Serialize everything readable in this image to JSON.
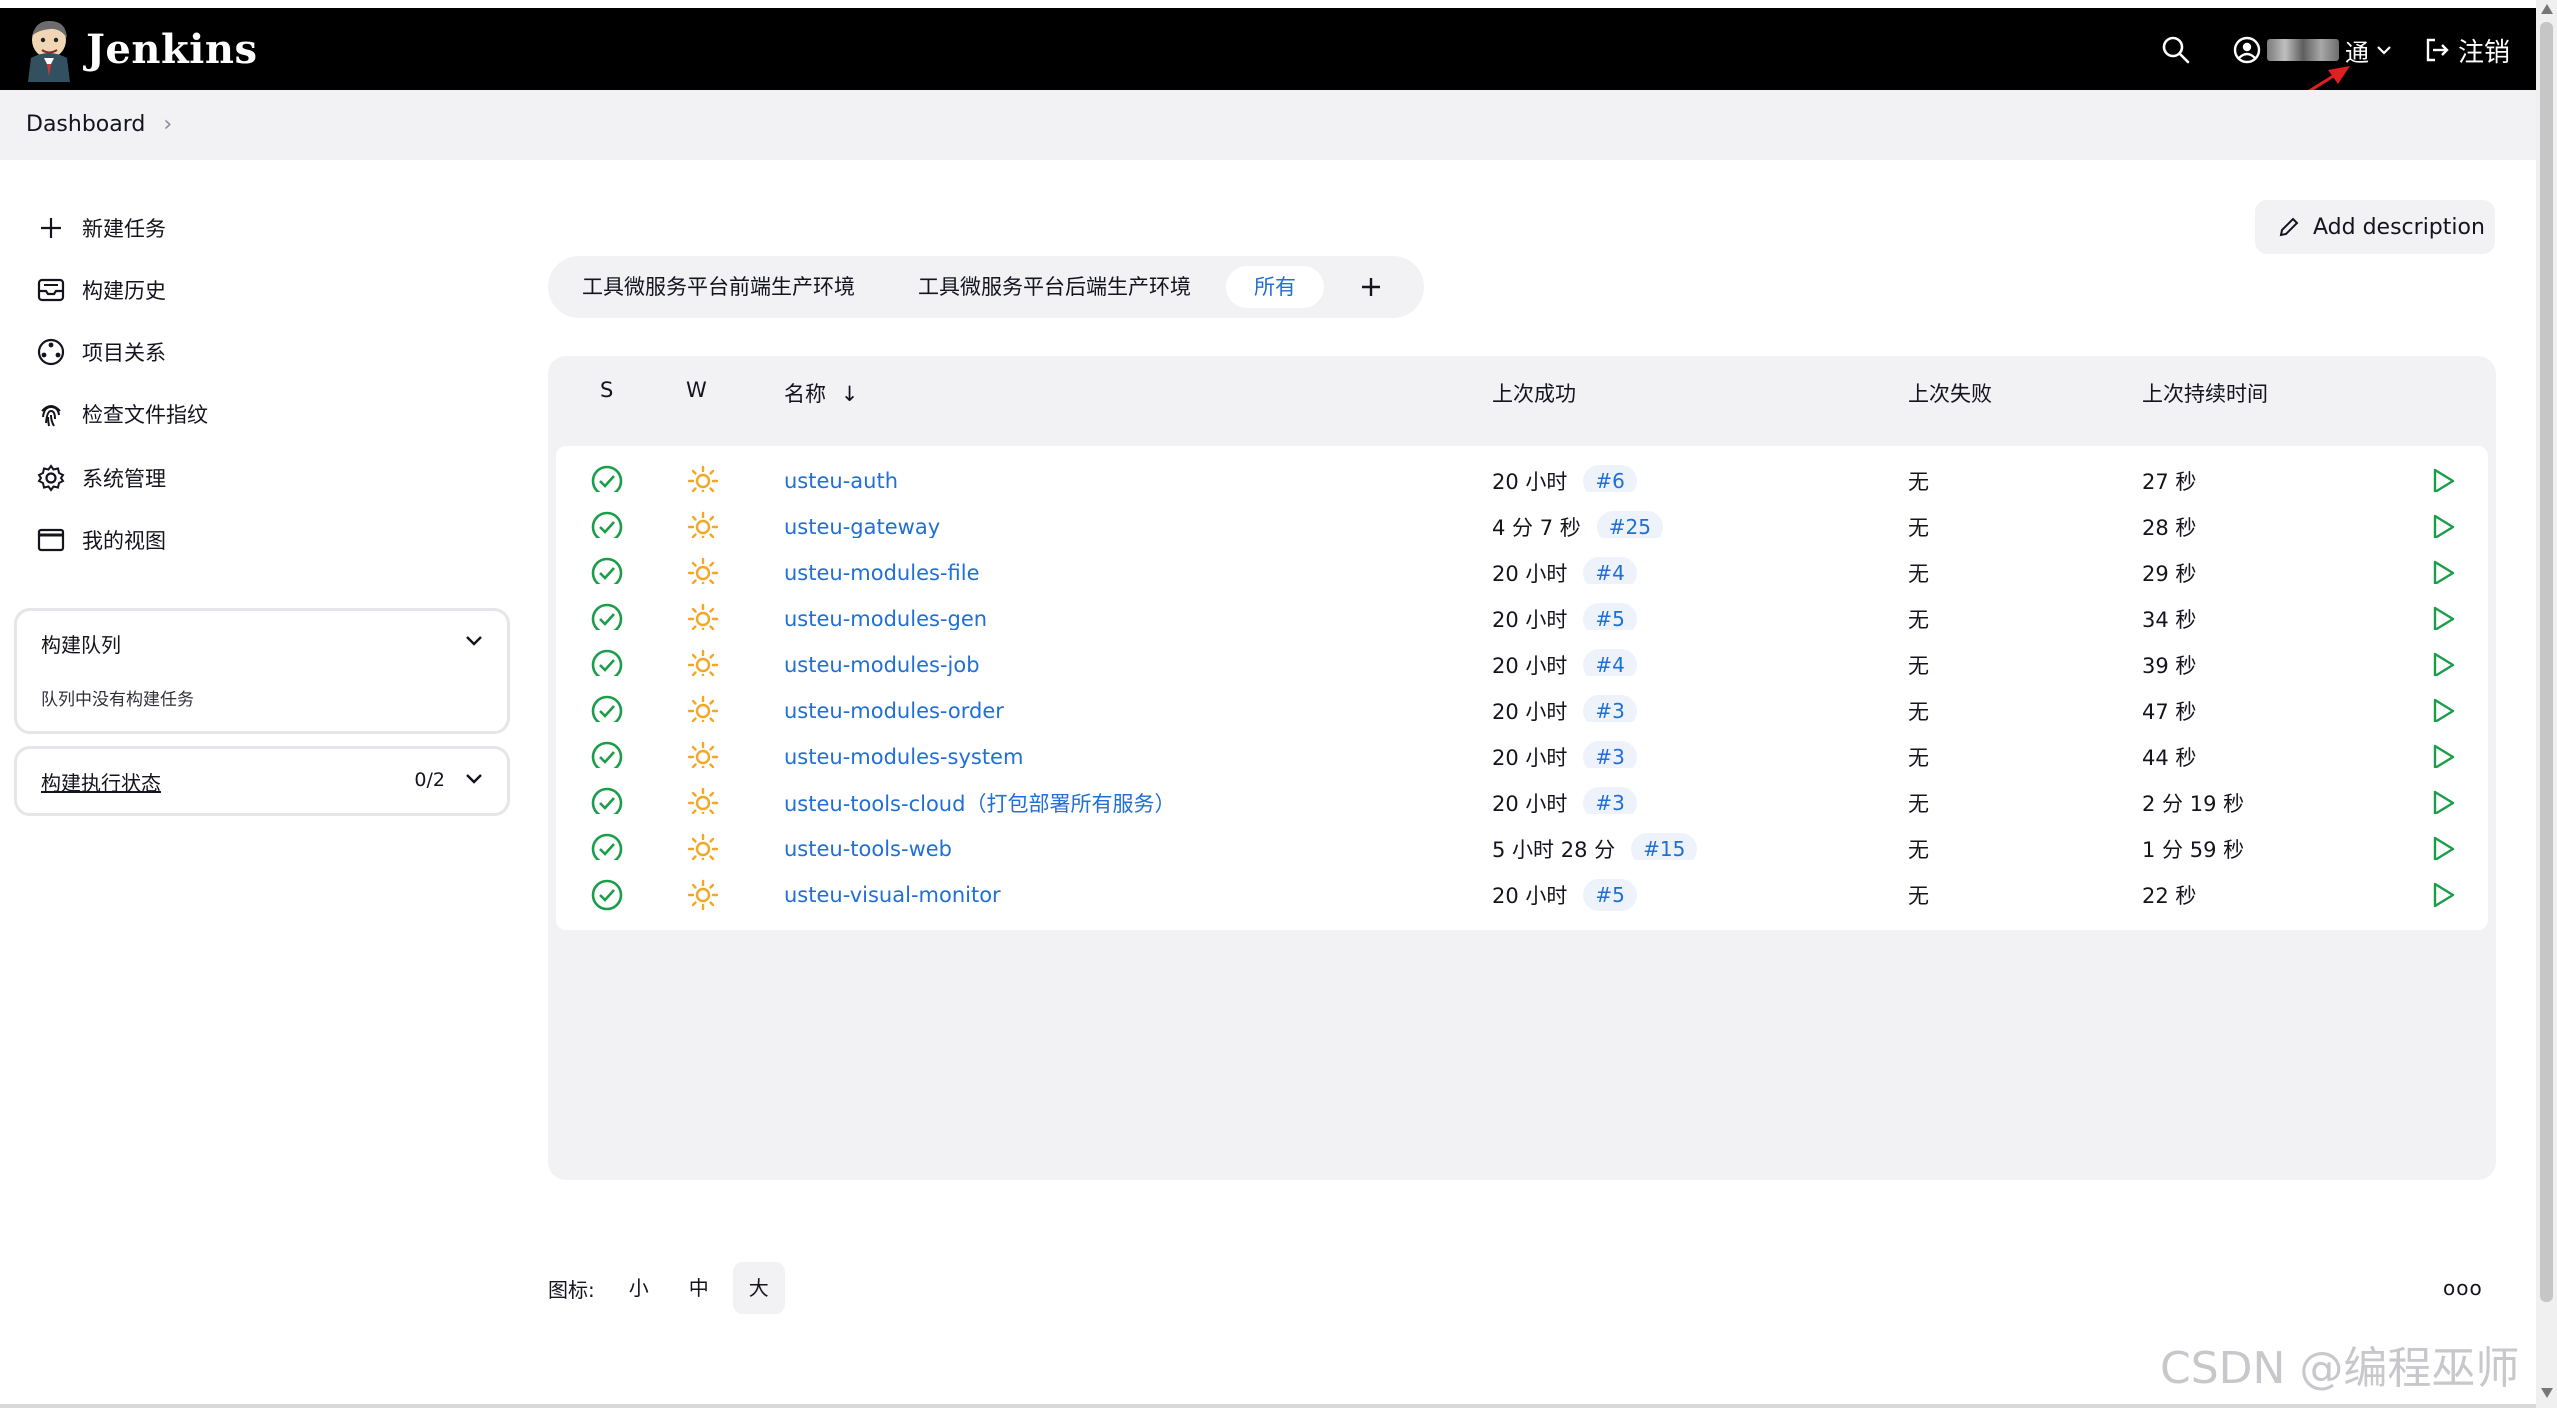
{
  "header": {
    "brand": "Jenkins",
    "user_name_visible": "通",
    "logout_label": "注销"
  },
  "breadcrumb": {
    "root": "Dashboard",
    "separator": "›"
  },
  "sidebar": {
    "tasks": [
      {
        "label": "新建任务",
        "icon": "plus-icon"
      },
      {
        "label": "构建历史",
        "icon": "inbox-icon"
      },
      {
        "label": "项目关系",
        "icon": "relationship-icon"
      },
      {
        "label": "检查文件指纹",
        "icon": "fingerprint-icon"
      },
      {
        "label": "系统管理",
        "icon": "gear-icon"
      },
      {
        "label": "我的视图",
        "icon": "window-icon"
      }
    ],
    "build_queue": {
      "title": "构建队列",
      "empty_text": "队列中没有构建任务"
    },
    "executors": {
      "title": "构建执行状态",
      "count": "0/2"
    }
  },
  "add_description": "Add description",
  "tabs": [
    {
      "label": "工具微服务平台前端生产环境",
      "active": false
    },
    {
      "label": "工具微服务平台后端生产环境",
      "active": false
    },
    {
      "label": "所有",
      "active": true
    }
  ],
  "table": {
    "headers": {
      "s": "S",
      "w": "W",
      "name": "名称",
      "sort": "↓",
      "last_success": "上次成功",
      "last_failure": "上次失败",
      "last_duration": "上次持续时间"
    },
    "rows": [
      {
        "name": "usteu-auth",
        "success_time": "20 小时",
        "build": "#6",
        "failure": "无",
        "duration": "27 秒"
      },
      {
        "name": "usteu-gateway",
        "success_time": "4 分 7 秒",
        "build": "#25",
        "failure": "无",
        "duration": "28 秒"
      },
      {
        "name": "usteu-modules-file",
        "success_time": "20 小时",
        "build": "#4",
        "failure": "无",
        "duration": "29 秒"
      },
      {
        "name": "usteu-modules-gen",
        "success_time": "20 小时",
        "build": "#5",
        "failure": "无",
        "duration": "34 秒"
      },
      {
        "name": "usteu-modules-job",
        "success_time": "20 小时",
        "build": "#4",
        "failure": "无",
        "duration": "39 秒"
      },
      {
        "name": "usteu-modules-order",
        "success_time": "20 小时",
        "build": "#3",
        "failure": "无",
        "duration": "47 秒"
      },
      {
        "name": "usteu-modules-system",
        "success_time": "20 小时",
        "build": "#3",
        "failure": "无",
        "duration": "44 秒"
      },
      {
        "name": "usteu-tools-cloud（打包部署所有服务）",
        "success_time": "20 小时",
        "build": "#3",
        "failure": "无",
        "duration": "2 分 19 秒"
      },
      {
        "name": "usteu-tools-web",
        "success_time": "5 小时 28 分",
        "build": "#15",
        "failure": "无",
        "duration": "1 分 59 秒"
      },
      {
        "name": "usteu-visual-monitor",
        "success_time": "20 小时",
        "build": "#5",
        "failure": "无",
        "duration": "22 秒"
      }
    ]
  },
  "footer": {
    "icon_label": "图标:",
    "sizes": [
      "小",
      "中",
      "大"
    ],
    "selected_size": "大",
    "more": "ooo"
  },
  "watermark": "CSDN @编程巫师",
  "colors": {
    "header_bg": "#000000",
    "link": "#1f6fd6",
    "success": "#1a9e4a",
    "weather": "#f5a623",
    "panel": "#f2f2f4"
  }
}
